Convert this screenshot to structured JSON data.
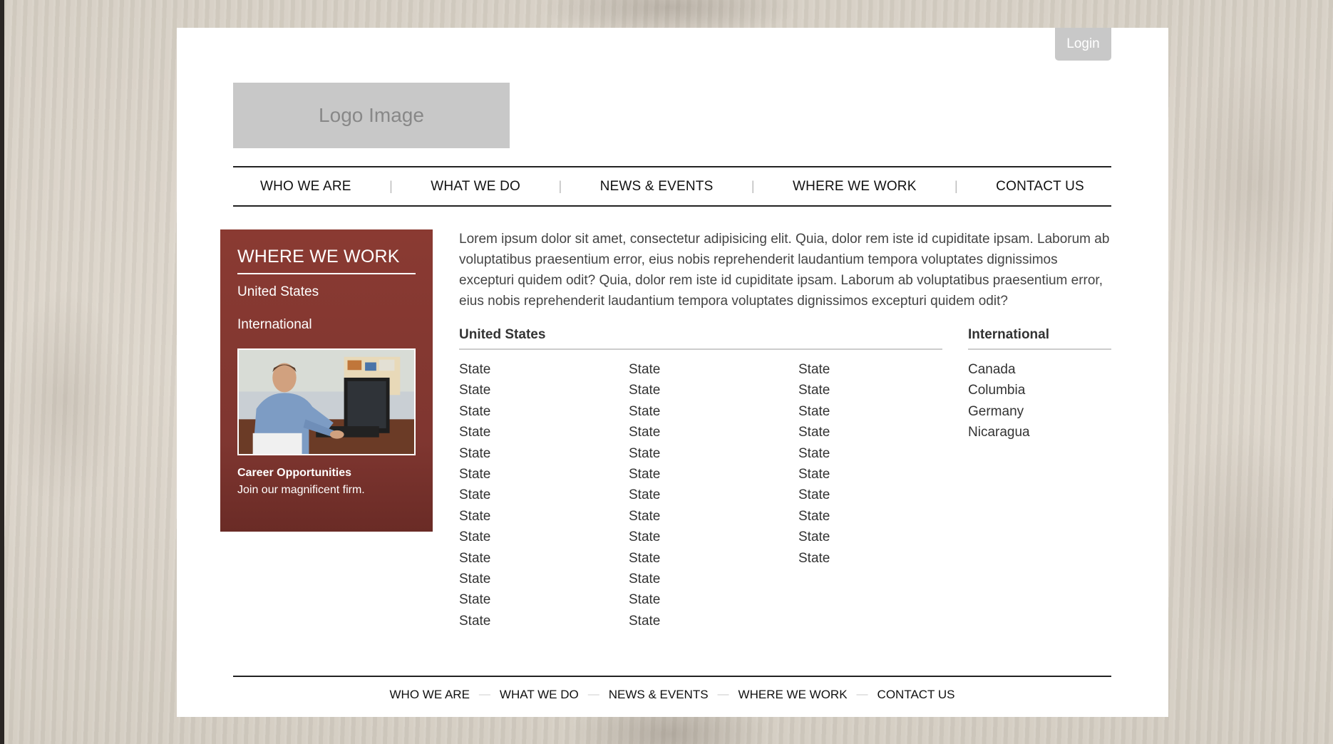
{
  "header": {
    "login_label": "Login",
    "logo_text": "Logo Image"
  },
  "nav": {
    "items": [
      "WHO WE ARE",
      "WHAT WE DO",
      "NEWS & EVENTS",
      "WHERE WE WORK",
      "CONTACT US"
    ],
    "separator": "|"
  },
  "sidebar": {
    "title": "WHERE WE WORK",
    "links": [
      "United States",
      "International"
    ],
    "career_title": "Career Opportunities",
    "career_text": "Join our magnificent firm."
  },
  "main": {
    "intro": "Lorem ipsum dolor sit amet, consectetur adipisicing elit. Quia, dolor rem iste id cupiditate ipsam. Laborum ab voluptatibus praesentium error, eius nobis reprehenderit laudantium tempora voluptates dignissimos excepturi quidem odit? Quia, dolor rem iste id cupiditate ipsam. Laborum ab voluptatibus praesentium error, eius nobis reprehenderit laudantium tempora voluptates dignissimos excepturi quidem odit?",
    "us_heading": "United States",
    "us_columns": [
      [
        "State",
        "State",
        "State",
        "State",
        "State",
        "State",
        "State",
        "State",
        "State",
        "State",
        "State",
        "State",
        "State"
      ],
      [
        "State",
        "State",
        "State",
        "State",
        "State",
        "State",
        "State",
        "State",
        "State",
        "State",
        "State",
        "State",
        "State"
      ],
      [
        "State",
        "State",
        "State",
        "State",
        "State",
        "State",
        "State",
        "State",
        "State",
        "State"
      ]
    ],
    "intl_heading": "International",
    "intl_items": [
      "Canada",
      "Columbia",
      "Germany",
      "Nicaragua"
    ]
  },
  "footer": {
    "items": [
      "WHO WE ARE",
      "WHAT WE DO",
      "NEWS & EVENTS",
      "WHERE WE WORK",
      "CONTACT US"
    ],
    "separator": "—"
  },
  "colors": {
    "sidebar_bg": "#8a3a32",
    "placeholder_gray": "#c8c8c8",
    "page_bg": "#ffffff"
  }
}
